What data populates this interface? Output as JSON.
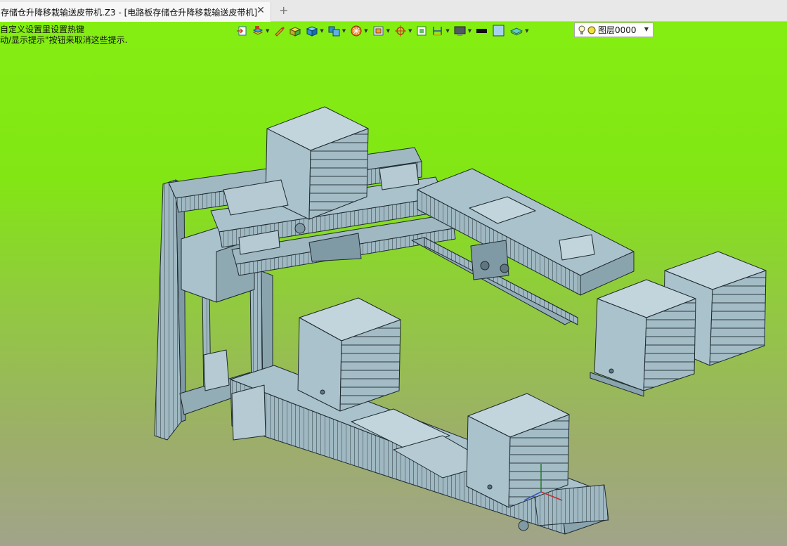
{
  "tab": {
    "title": "存储仓升降移栽输送皮带机.Z3 - [电路板存储仓升降移栽输送皮带机]",
    "close_glyph": "✕",
    "new_glyph": "+"
  },
  "hint": {
    "line1": "自定义设置里设置热键",
    "line2": "动/显示提示\"按钮来取消这些提示."
  },
  "toolbar": {
    "layer_value": "图层0000",
    "icons": [
      "import-icon",
      "layers-stack-icon",
      "pen-icon",
      "box-yellow-icon",
      "cube-blue-icon",
      "cube-multi-icon",
      "render-mode-icon",
      "view-cube-icon",
      "pivot-icon",
      "zoom-fit-icon",
      "dimension-icon",
      "display-icon",
      "color-swatch-icon",
      "fill-swatch-icon",
      "sheet-icon",
      "lightbulb-icon"
    ]
  },
  "colors": {
    "viewport_top": "#84ee12",
    "viewport_bottom": "#a1a48a",
    "model_face": "#a9c2cc",
    "model_face_dark": "#7f9aa5",
    "model_edge": "#1e2a30"
  }
}
